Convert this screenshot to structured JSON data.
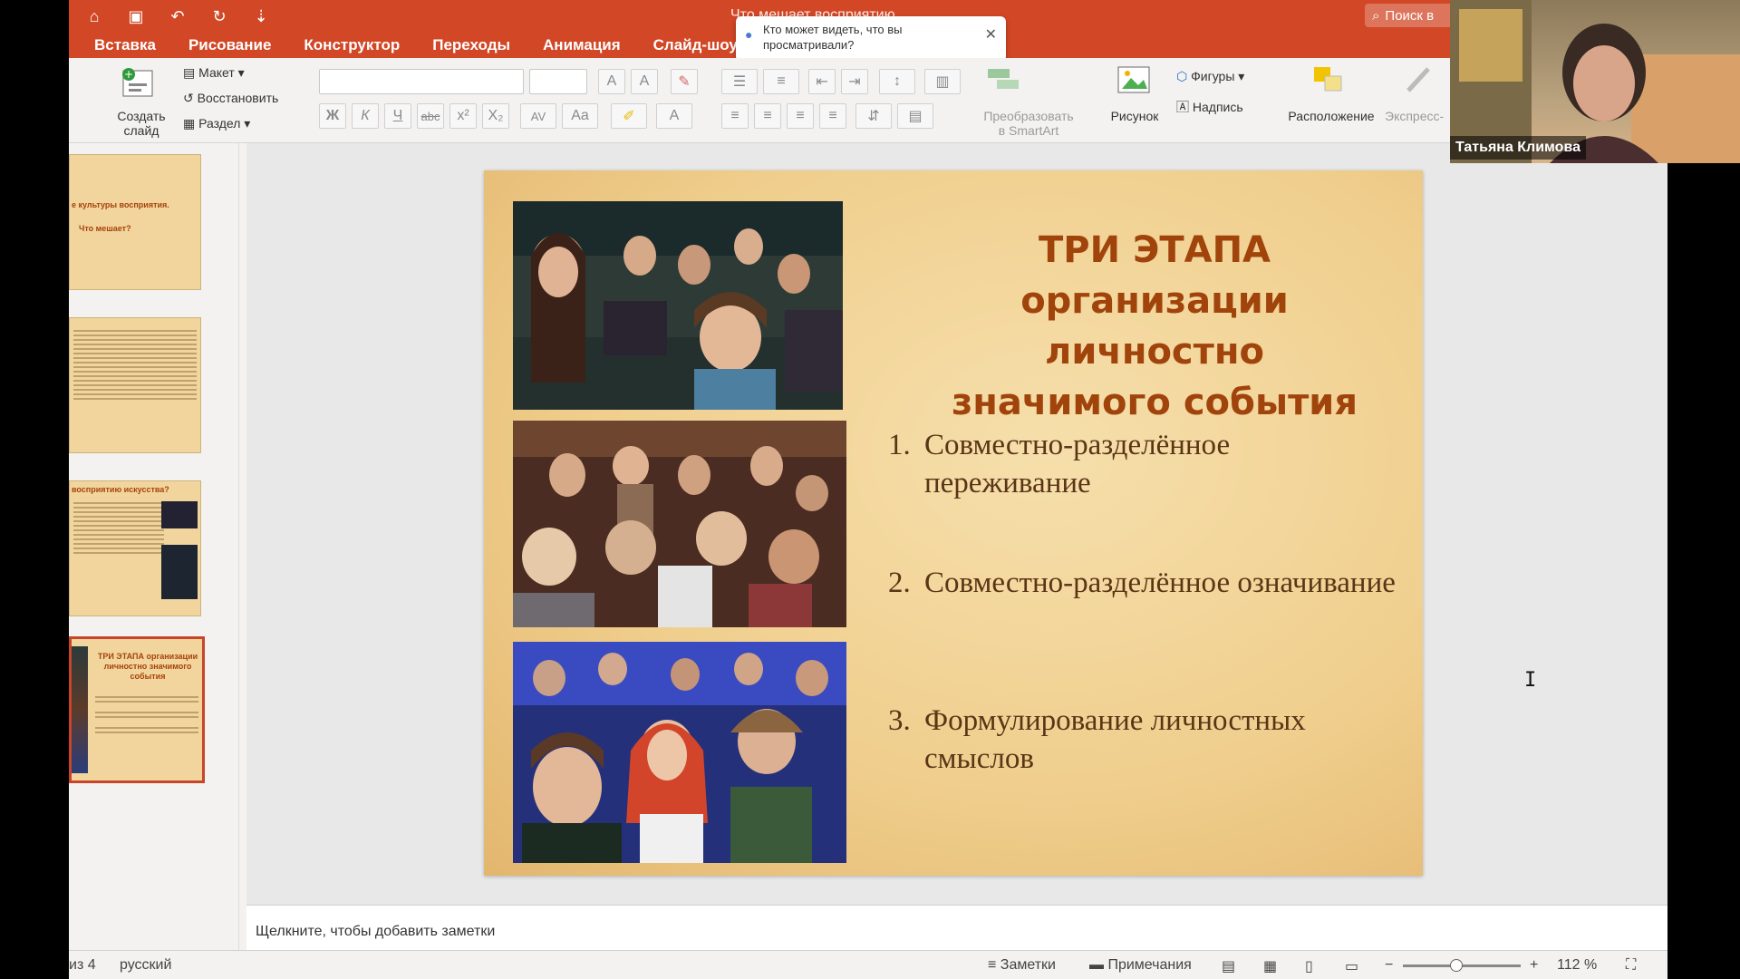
{
  "title_bar": {
    "doc_title": "Что мешает восприятию",
    "search_placeholder": "Поиск в"
  },
  "tabs": [
    "Вставка",
    "Рисование",
    "Конструктор",
    "Переходы",
    "Анимация",
    "Слайд-шоу"
  ],
  "share_popup": {
    "text": "Кто может видеть, что вы просматривали?"
  },
  "ribbon": {
    "new_slide": "Создать слайд",
    "layout": "Макет",
    "reset": "Восстановить",
    "section": "Раздел",
    "convert_smartart": "Преобразовать в SmartArt",
    "picture": "Рисунок",
    "shapes": "Фигуры",
    "textbox": "Надпись",
    "arrange": "Расположение",
    "express": "Экспресс-",
    "bold": "Ж",
    "italic": "К",
    "underline": "Ч",
    "strike": "abc",
    "superscript": "x²",
    "subscript": "X₂",
    "spacing": "AV",
    "case": "Aa",
    "font_color": "A",
    "grow_font": "A",
    "shrink_font": "A"
  },
  "thumbnails": [
    {
      "title": "е культуры восприятия.",
      "subtitle": "Что мешает?"
    },
    {
      "title": ""
    },
    {
      "title": "восприятию искусства?"
    },
    {
      "title": "ТРИ ЭТАПА организации личностно значимого события"
    }
  ],
  "slide": {
    "title_line1": "ТРИ ЭТАПА",
    "title_line2": "организации личностно",
    "title_line3": "значимого события",
    "items": [
      {
        "num": "1.",
        "text": "Совместно-разделённое переживание"
      },
      {
        "num": "2.",
        "text": "Совместно-разделённое означивание"
      },
      {
        "num": "3.",
        "text": "Формулирование личностных смыслов"
      }
    ]
  },
  "notes_placeholder": "Щелкните, чтобы добавить заметки",
  "status": {
    "slide_counter": "из 4",
    "language": "русский",
    "notes_btn": "Заметки",
    "comments_btn": "Примечания",
    "zoom": "112 %",
    "zoom_fraction": 0.45
  },
  "webcam": {
    "participant_name": "Татьяна Климова"
  },
  "colors": {
    "accent": "#d24726",
    "slide_title": "#a0440c",
    "slide_body": "#5a3516"
  },
  "icons": [
    "home-icon",
    "save-icon",
    "undo-icon",
    "redo-icon",
    "customize-icon",
    "search-icon",
    "close-icon"
  ]
}
